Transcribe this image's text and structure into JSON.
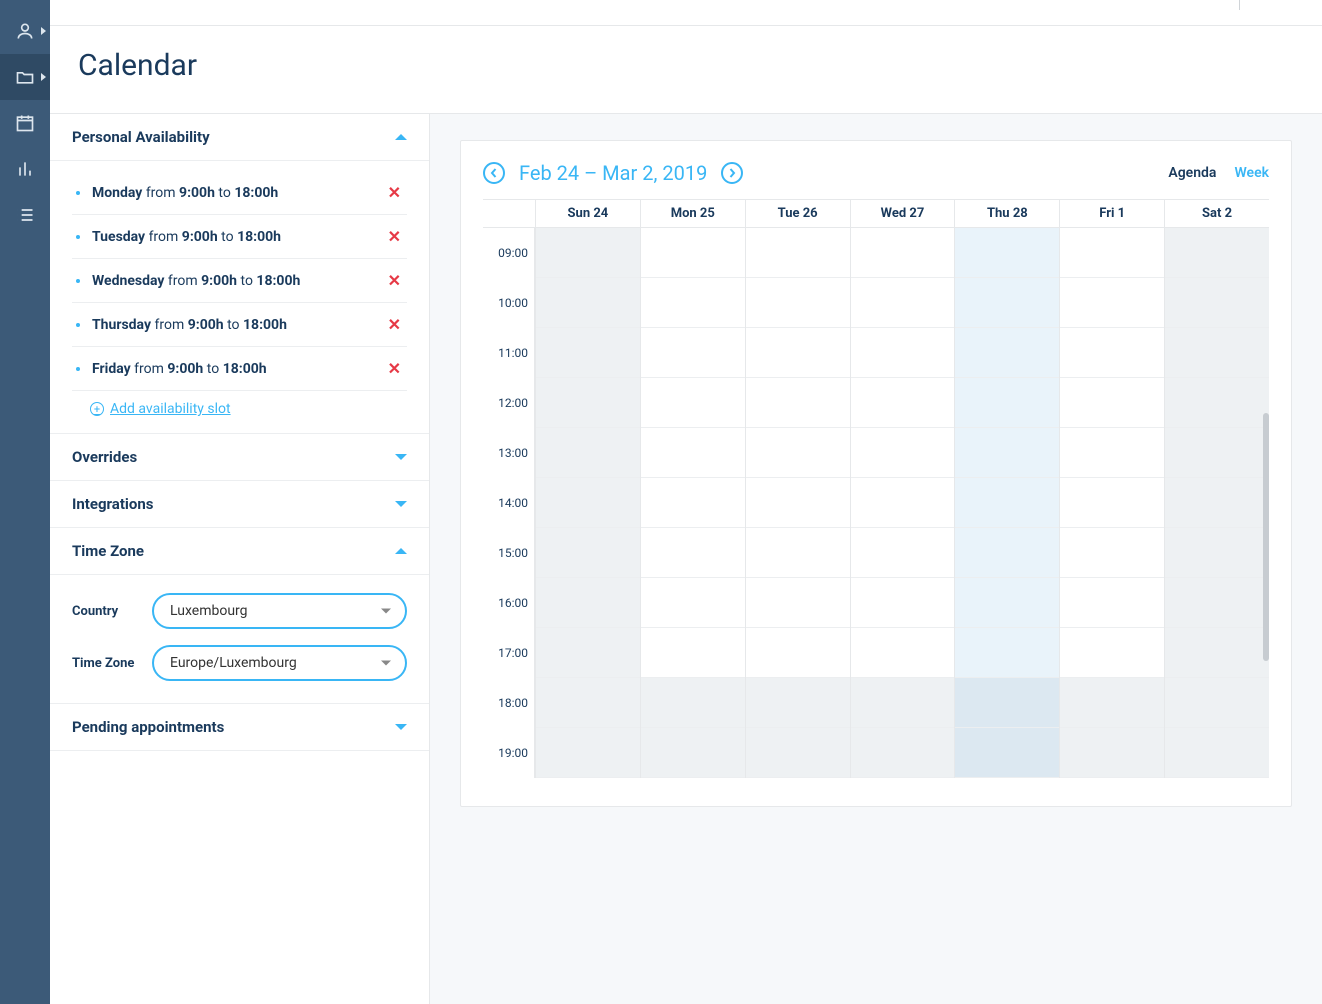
{
  "page": {
    "title": "Calendar"
  },
  "sidebar": {
    "availability_title": "Personal Availability",
    "slots": [
      {
        "day": "Monday",
        "from": "9:00h",
        "to": "18:00h"
      },
      {
        "day": "Tuesday",
        "from": "9:00h",
        "to": "18:00h"
      },
      {
        "day": "Wednesday",
        "from": "9:00h",
        "to": "18:00h"
      },
      {
        "day": "Thursday",
        "from": "9:00h",
        "to": "18:00h"
      },
      {
        "day": "Friday",
        "from": "9:00h",
        "to": "18:00h"
      }
    ],
    "from_word": "from",
    "to_word": "to",
    "add_slot": "Add availability slot",
    "overrides_title": "Overrides",
    "integrations_title": "Integrations",
    "timezone_title": "Time Zone",
    "tz_country_label": "Country",
    "tz_country_value": "Luxembourg",
    "tz_zone_label": "Time Zone",
    "tz_zone_value": "Europe/Luxembourg",
    "pending_title": "Pending appointments"
  },
  "calendar": {
    "date_range": "Feb 24 – Mar 2, 2019",
    "view_agenda": "Agenda",
    "view_week": "Week",
    "days": [
      "Sun 24",
      "Mon 25",
      "Tue 26",
      "Wed 27",
      "Thu 28",
      "Fri 1",
      "Sat 2"
    ],
    "day_types": [
      "weekend",
      "",
      "",
      "",
      "today",
      "",
      "weekend"
    ],
    "hours": [
      "09:00",
      "10:00",
      "11:00",
      "12:00",
      "13:00",
      "14:00",
      "15:00",
      "16:00",
      "17:00",
      "18:00",
      "19:00"
    ],
    "off_hours": [
      "18:00",
      "19:00"
    ]
  }
}
